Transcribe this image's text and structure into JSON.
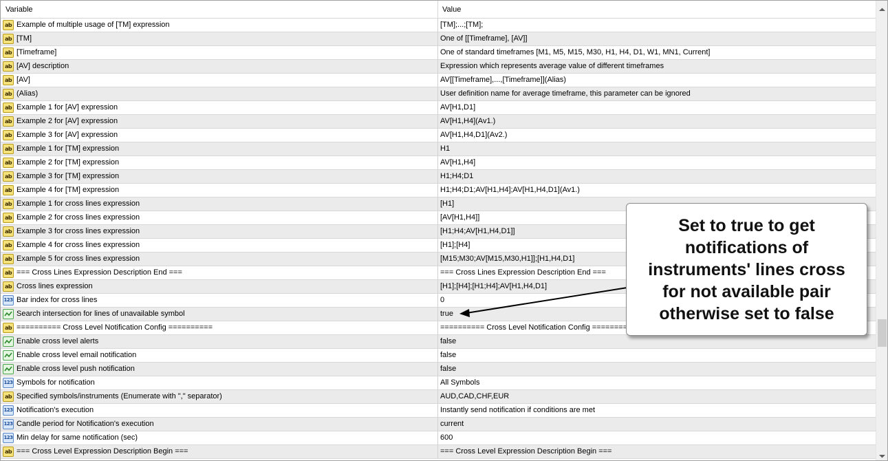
{
  "header": {
    "variable": "Variable",
    "value": "Value"
  },
  "rows": [
    {
      "icon": "text-icon",
      "variable": "Example of multiple usage of [TM] expression",
      "value": "[TM];...;[TM];"
    },
    {
      "icon": "text-icon",
      "variable": "[TM]",
      "value": "One of [[Timeframe], [AV]]"
    },
    {
      "icon": "text-icon",
      "variable": "[Timeframe]",
      "value": "One of standard timeframes [M1, M5, M15, M30, H1, H4, D1, W1, MN1, Current]"
    },
    {
      "icon": "text-icon",
      "variable": "[AV] description",
      "value": "Expression which represents average value of different timeframes"
    },
    {
      "icon": "text-icon",
      "variable": "[AV]",
      "value": "AV[[Timeframe],...,[Timeframe]](Alias)"
    },
    {
      "icon": "text-icon",
      "variable": "(Alias)",
      "value": "User definition name for average timeframe, this parameter can be ignored"
    },
    {
      "icon": "text-icon",
      "variable": "Example 1 for [AV] expression",
      "value": "AV[H1,D1]"
    },
    {
      "icon": "text-icon",
      "variable": "Example 2 for [AV] expression",
      "value": "AV[H1,H4](Av1.)"
    },
    {
      "icon": "text-icon",
      "variable": "Example 3 for [AV] expression",
      "value": "AV[H1,H4,D1](Av2.)"
    },
    {
      "icon": "text-icon",
      "variable": "Example 1 for [TM] expression",
      "value": "H1"
    },
    {
      "icon": "text-icon",
      "variable": "Example 2 for [TM] expression",
      "value": "AV[H1,H4]"
    },
    {
      "icon": "text-icon",
      "variable": "Example 3 for [TM] expression",
      "value": "H1;H4;D1"
    },
    {
      "icon": "text-icon",
      "variable": "Example 4 for [TM] expression",
      "value": "H1;H4;D1;AV[H1,H4];AV[H1,H4,D1](Av1.)"
    },
    {
      "icon": "text-icon",
      "variable": "Example 1 for cross lines expression",
      "value": "[H1]"
    },
    {
      "icon": "text-icon",
      "variable": "Example 2 for cross lines expression",
      "value": "[AV[H1,H4]]"
    },
    {
      "icon": "text-icon",
      "variable": "Example 3 for cross lines expression",
      "value": "[H1;H4;AV[H1,H4,D1]]"
    },
    {
      "icon": "text-icon",
      "variable": "Example 4 for cross lines expression",
      "value": "[H1];[H4]"
    },
    {
      "icon": "text-icon",
      "variable": "Example 5 for cross lines expression",
      "value": "[M15;M30;AV[M15,M30,H1]];[H1,H4,D1]"
    },
    {
      "icon": "text-icon",
      "variable": "=== Cross Lines Expression Description End ===",
      "value": "=== Cross Lines Expression Description End ==="
    },
    {
      "icon": "text-icon",
      "variable": "Cross lines expression",
      "value": "[H1];[H4];[H1;H4];AV[H1,H4,D1]"
    },
    {
      "icon": "integer-icon",
      "variable": "Bar index for cross lines",
      "value": "0"
    },
    {
      "icon": "bool-icon",
      "variable": "Search intersection for lines of unavailable symbol",
      "value": "true"
    },
    {
      "icon": "text-icon",
      "variable": "========== Cross Level Notification Config ==========",
      "value": "========== Cross Level Notification Config =========="
    },
    {
      "icon": "bool-icon",
      "variable": "Enable cross level alerts",
      "value": "false"
    },
    {
      "icon": "bool-icon",
      "variable": "Enable cross level email notification",
      "value": "false"
    },
    {
      "icon": "bool-icon",
      "variable": "Enable cross level push notification",
      "value": "false"
    },
    {
      "icon": "integer-icon",
      "variable": "Symbols for notification",
      "value": "All Symbols"
    },
    {
      "icon": "text-icon",
      "variable": "Specified symbols/instruments (Enumerate with \",\" separator)",
      "value": "AUD,CAD,CHF,EUR"
    },
    {
      "icon": "integer-icon",
      "variable": "Notification's execution",
      "value": "Instantly send notification if conditions are met"
    },
    {
      "icon": "integer-icon",
      "variable": "Candle period for Notification's execution",
      "value": "current"
    },
    {
      "icon": "integer-icon",
      "variable": "Min delay for same notification (sec)",
      "value": "600"
    },
    {
      "icon": "text-icon",
      "variable": "=== Cross Level Expression Description Begin ===",
      "value": "=== Cross Level Expression Description Begin ==="
    }
  ],
  "icon_labels": {
    "text": "ab",
    "integer": "123"
  },
  "callout": {
    "lines": [
      "Set to true to get",
      "notifications of",
      "instruments' lines cross",
      "for not available pair",
      "otherwise set to false"
    ]
  },
  "colors": {
    "row_alt": "#ebebeb",
    "grid": "#d8d8d8",
    "arrow": "#000000"
  }
}
